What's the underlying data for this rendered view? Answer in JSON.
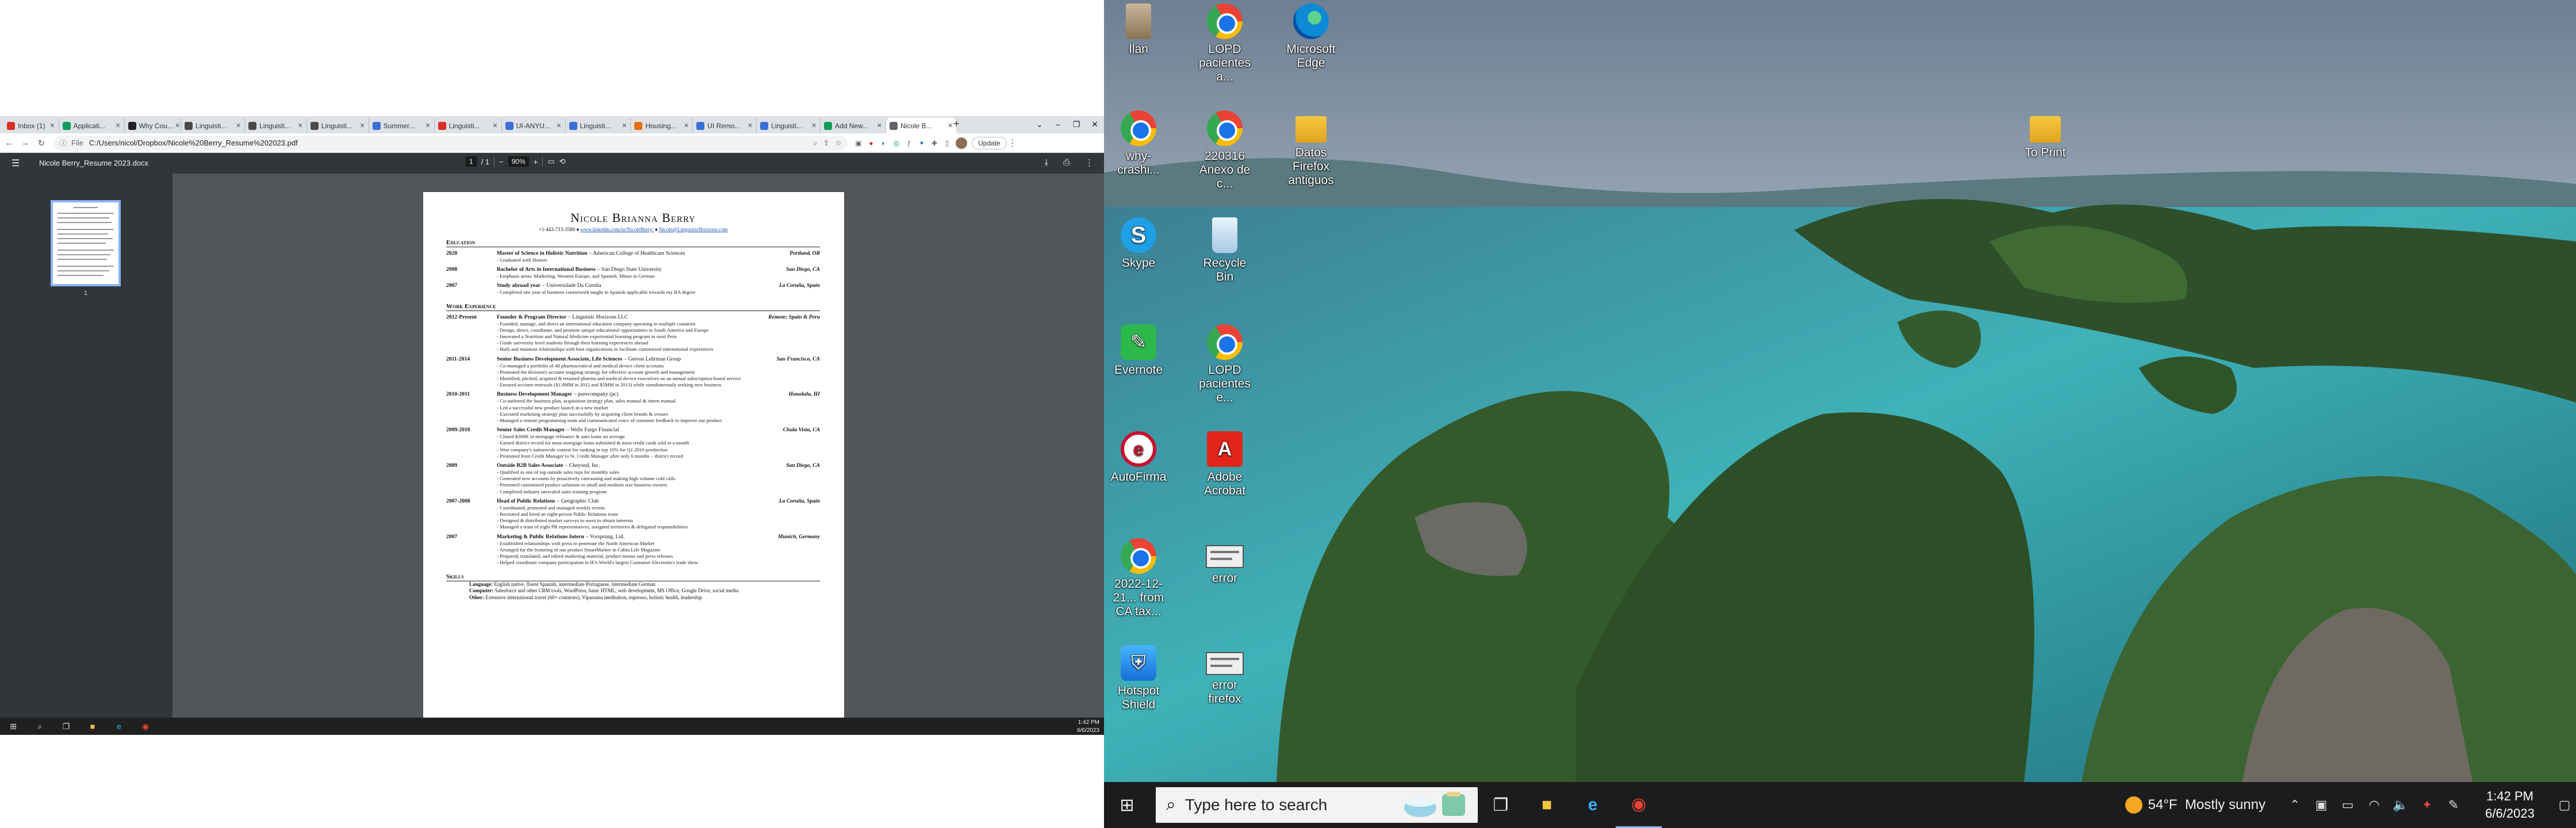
{
  "browser": {
    "tabs": [
      {
        "label": "Inbox (1)",
        "color": "#d93025",
        "active": false
      },
      {
        "label": "Applicati...",
        "color": "#0f9d58",
        "active": false
      },
      {
        "label": "Why Cou...",
        "color": "#202124",
        "active": false
      },
      {
        "label": "Linguisti...",
        "color": "#4a4a4a",
        "active": false
      },
      {
        "label": "Linguisti...",
        "color": "#4a4a4a",
        "active": false
      },
      {
        "label": "Linguisti...",
        "color": "#4a4a4a",
        "active": false
      },
      {
        "label": "Summer...",
        "color": "#3b6fd8",
        "active": false
      },
      {
        "label": "Linguisti...",
        "color": "#d93025",
        "active": false
      },
      {
        "label": "UI-ANYU...",
        "color": "#3b6fd8",
        "active": false
      },
      {
        "label": "Linguisti...",
        "color": "#3b6fd8",
        "active": false
      },
      {
        "label": "Housing...",
        "color": "#e8710a",
        "active": false
      },
      {
        "label": "UI Remo...",
        "color": "#3b6fd8",
        "active": false
      },
      {
        "label": "Linguisti...",
        "color": "#3b6fd8",
        "active": false
      },
      {
        "label": "Add New...",
        "color": "#0f9d58",
        "active": false
      },
      {
        "label": "Nicole B...",
        "color": "#5f6368",
        "active": true
      }
    ],
    "address_label": "File",
    "address": "C:/Users/nicol/Dropbox/Nicole%20Berry_Resume%202023.pdf",
    "update_label": "Update"
  },
  "pdf": {
    "filename": "Nicole Berry_Resume 2023.docx",
    "page_current": "1",
    "page_total": "/ 1",
    "zoom": "90%",
    "thumb_label": "1"
  },
  "resume": {
    "name": "Nicole Brianna Berry",
    "phone": "+1-443-713-3580",
    "linkedin": "www.linkedin.com/in/NicoleBerry/",
    "email": "Nicole@LinguisticHorizons.com",
    "sec_education": "Education",
    "education": [
      {
        "date": "2020",
        "title": "Master of Science in Holistic Nutrition",
        "org": "– American College of Healthcare Sciences",
        "loc": "Portland, OR",
        "bullets": [
          "Graduated with Honors"
        ]
      },
      {
        "date": "2008",
        "title": "Bachelor of Arts in International Business",
        "org": "– San Diego State University",
        "loc": "San Diego, CA",
        "bullets": [
          "Emphasis areas: Marketing, Western Europe, and Spanish. Minor in German"
        ]
      },
      {
        "date": "2007",
        "title": "Study abroad year",
        "org": "– Universidade Da Coruña",
        "loc": "La Coruña, Spain",
        "bullets": [
          "Completed one year of business coursework taught in Spanish applicable towards my BA degree"
        ]
      }
    ],
    "sec_work": "Work Experience",
    "work": [
      {
        "date": "2012-Present",
        "title": "Founder & Program Director",
        "org": "– Linguistic Horizons LLC",
        "loc": "Remote; Spain & Peru",
        "bullets": [
          "Founded, manage, and direct an international education company operating in multiple countries",
          "Design, direct, coordinate, and promote unique educational opportunities in South America and Europe",
          "Innovated a Nutrition and Natural Medicine experiential learning program in rural Peru",
          "Guide university level students through their learning experiences abroad",
          "Built and maintain relationships with host organizations to facilitate customized international experiences"
        ]
      },
      {
        "date": "2011-2014",
        "title": "Senior Business Development Associate, Life Sciences",
        "org": "– Gerson Lehrman Group",
        "loc": "San Francisco, CA",
        "bullets": [
          "Co-managed a portfolio of 40 pharmaceutical and medical device client accounts",
          "Promoted the division's account mapping strategy for effective account growth and management",
          "Identified, pitched, acquired & retained pharma and medical device executives on an annual subscription-based service",
          "Ensured account renewals ($1.9MM in 2012 and $5MM in 2013) while simultaneously seeking new business"
        ]
      },
      {
        "date": "2010-2011",
        "title": "Business Development Manager",
        "org": "– purecompany (pc)",
        "loc": "Honolulu, HI",
        "bullets": [
          "Co-authored the business plan, acquisition strategy plan, sales manual & intern manual",
          "Led a successful new product launch in a new market",
          "Executed marketing strategy plan successfully by acquiring client brands & venues",
          "Managed a remote programming team and communicated voice of customer feedback to improve our product"
        ]
      },
      {
        "date": "2009-2010",
        "title": "Senior Sales Credit Manager",
        "org": "– Wells Fargo Financial",
        "loc": "Chula Vista, CA",
        "bullets": [
          "Closed $300K in mortgage refinance & auto loans on average",
          "Earned district record for most mortgage loans submitted & most credit cards sold in a month",
          "Won company's nationwide contest for ranking in top 10% for Q1 2010 production",
          "Promoted from Credit Manager to Sr. Credit Manager after only 6 months – district record"
        ]
      },
      {
        "date": "2009",
        "title": "Outside B2B Sales Associate",
        "org": "– Cheyond, Inc.",
        "loc": "San Diego, CA",
        "bullets": [
          "Qualified as one of top outside sales reps for monthly sales",
          "Generated new accounts by proactively canvassing and making high volume cold calls",
          "Presented customized product solutions to small and medium size business owners",
          "Completed industry unrivaled sales training program"
        ]
      },
      {
        "date": "2007-2008",
        "title": "Head of Public Relations",
        "org": "– Geographic Club",
        "loc": "La Coruña, Spain",
        "bullets": [
          "Coordinated, promoted and managed weekly events",
          "Recruited and hired an eight-person Public Relations team",
          "Designed & distributed market surveys to users to obtain interests",
          "Managed a team of eight PR representatives, assigned territories & delegated responsibilities"
        ]
      },
      {
        "date": "2007",
        "title": "Marketing & Public Relations Intern",
        "org": "– Vorsprung, Ltd.",
        "loc": "Munich, Germany",
        "bullets": [
          "Established relationships with press to penetrate the North American Market",
          "Arranged for the featuring of our product SmartMarker in Cabin Life Magazine",
          "Prepared, translated, and edited marketing material, product menus and press releases",
          "Helped coordinate company participation in IFA World's largest Consumer Electronics trade show"
        ]
      }
    ],
    "sec_skills": "Skills",
    "skills": [
      {
        "k": "Language:",
        "v": "English native, fluent Spanish, intermediate Portuguese, intermediate German"
      },
      {
        "k": "Computer:",
        "v": "Salesforce and other CRM tools, WordPress, basic HTML, web development, MS Office, Google Drive, social media"
      },
      {
        "k": "Other:",
        "v": "Extensive international travel (60+ countries), Vipassana meditation, espresso, holistic health, leadership"
      }
    ]
  },
  "left_taskbar": {
    "time": "1:42 PM",
    "date": "6/6/2023"
  },
  "desktop": {
    "icons": [
      {
        "label": "Ilan",
        "kind": "ilan-icon"
      },
      {
        "label": "LOPD pacientes a...",
        "kind": "chrome-icon"
      },
      {
        "label": "Microsoft Edge",
        "kind": "edge-icon"
      },
      {
        "label": "why-crashi...",
        "kind": "chrome-icon"
      },
      {
        "label": "220316 Anexo de c...",
        "kind": "chrome-icon"
      },
      {
        "label": "Datos Firefox antiguos",
        "kind": "folder-icon"
      },
      {
        "label": "To Print",
        "kind": "folder-icon"
      },
      {
        "label": "Skype",
        "kind": "skype-icon"
      },
      {
        "label": "Recycle Bin",
        "kind": "recycle-bin-icon"
      },
      {
        "label": "Evernote",
        "kind": "evernote-icon"
      },
      {
        "label": "LOPD pacientes e...",
        "kind": "chrome-icon"
      },
      {
        "label": "AutoFirma",
        "kind": "autofirma-icon"
      },
      {
        "label": "Adobe Acrobat",
        "kind": "acrobat-icon"
      },
      {
        "label": "2022-12-21... from CA tax...",
        "kind": "chrome-icon"
      },
      {
        "label": "error",
        "kind": "image-icon"
      },
      {
        "label": "Hotspot Shield",
        "kind": "hotspot-shield-icon"
      },
      {
        "label": "error firefox",
        "kind": "image-icon"
      }
    ]
  },
  "right_taskbar": {
    "search_placeholder": "Type here to search",
    "temperature": "54°F",
    "weather": "Mostly sunny",
    "time": "1:42 PM",
    "date": "6/6/2023"
  },
  "colors": {
    "accent": "#1a73e8",
    "pdf_toolbar": "#323639",
    "pdf_bg": "#525659",
    "taskbar": "#1c1c1e"
  }
}
